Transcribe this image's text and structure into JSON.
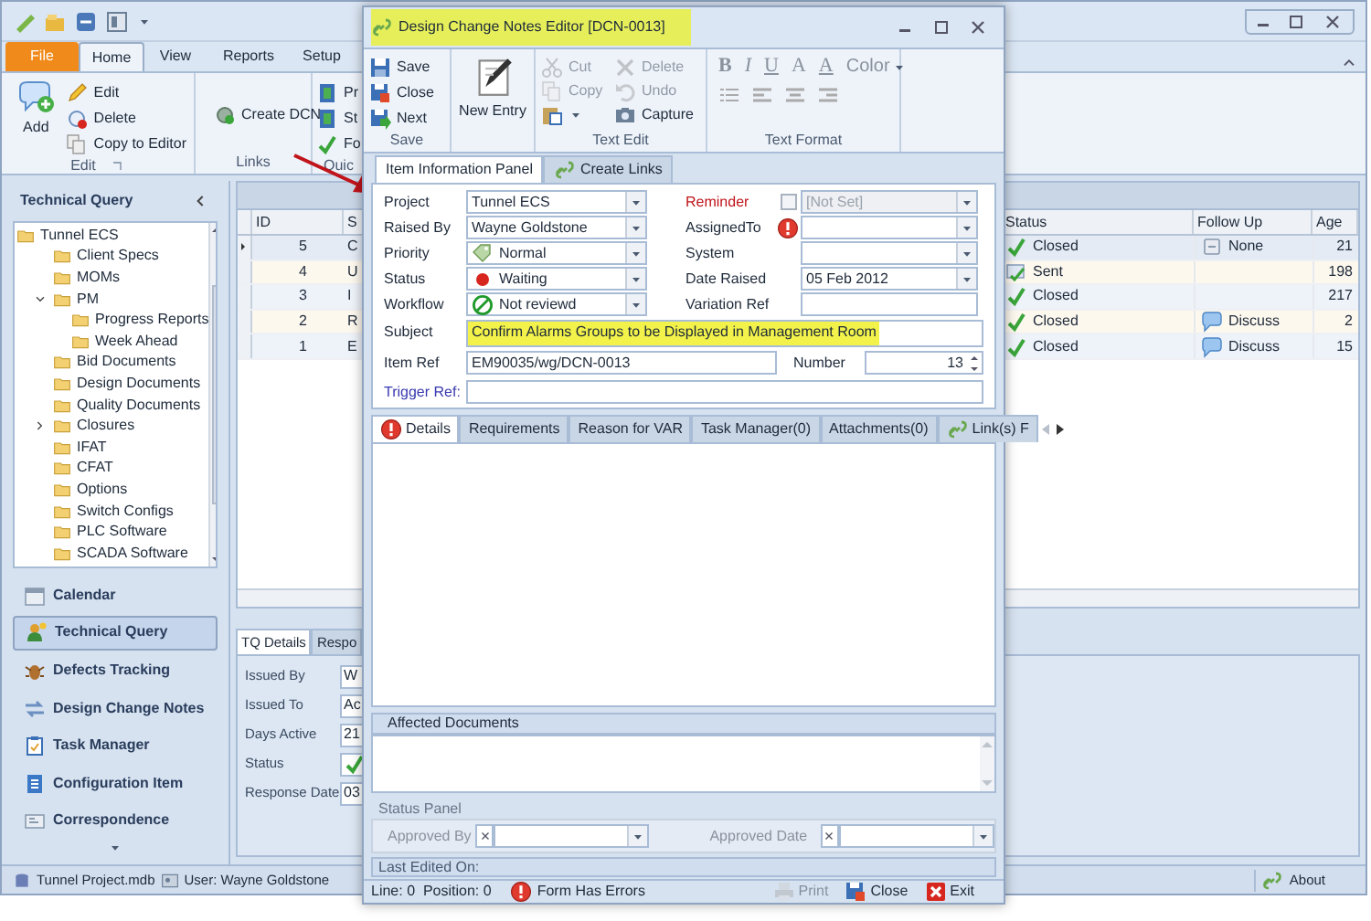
{
  "app": {
    "ribbon_tabs": [
      {
        "label": "File",
        "kind": "file",
        "selected": false
      },
      {
        "label": "Home",
        "kind": "tab",
        "selected": true
      },
      {
        "label": "View",
        "kind": "tab",
        "selected": false
      },
      {
        "label": "Reports",
        "kind": "tab",
        "selected": false
      },
      {
        "label": "Setup",
        "kind": "tab",
        "selected": false
      }
    ],
    "ribbon_groups": [
      {
        "label": "Edit",
        "large": {
          "label": "Add"
        },
        "items": [
          {
            "label": "Edit",
            "kind": "pencil"
          },
          {
            "label": "Delete",
            "kind": "minus"
          },
          {
            "label": "Copy to Editor",
            "kind": "copy"
          }
        ]
      },
      {
        "label": "Links",
        "items": [
          {
            "label": "Create DCN",
            "kind": "gear"
          }
        ]
      },
      {
        "label": "Quic",
        "items": [
          {
            "label": "Pr",
            "kind": "book"
          },
          {
            "label": "St",
            "kind": "book"
          },
          {
            "label": "Fo",
            "kind": "check"
          }
        ]
      }
    ],
    "nav": {
      "title": "Technical Query",
      "tree": [
        {
          "label": "Tunnel ECS",
          "children": [
            {
              "label": "Client Specs"
            },
            {
              "label": "MOMs"
            },
            {
              "label": "PM",
              "expanded": true,
              "children": [
                {
                  "label": "Progress Reports"
                },
                {
                  "label": "Week Ahead"
                }
              ]
            },
            {
              "label": "Bid Documents"
            },
            {
              "label": "Design Documents"
            },
            {
              "label": "Quality Documents"
            },
            {
              "label": "Closures",
              "expanded": false
            },
            {
              "label": "IFAT"
            },
            {
              "label": "CFAT"
            },
            {
              "label": "Options"
            },
            {
              "label": "Switch Configs"
            },
            {
              "label": "PLC Software"
            },
            {
              "label": "SCADA Software"
            }
          ]
        }
      ]
    },
    "nav_buttons": [
      {
        "label": "Calendar",
        "kind": "calendar",
        "selected": false
      },
      {
        "label": "Technical Query",
        "kind": "person",
        "selected": true
      },
      {
        "label": "Defects Tracking",
        "kind": "bug",
        "selected": false
      },
      {
        "label": "Design Change Notes",
        "kind": "exchange",
        "selected": false
      },
      {
        "label": "Task Manager",
        "kind": "clipboard",
        "selected": false
      },
      {
        "label": "Configuration Item",
        "kind": "document",
        "selected": false
      },
      {
        "label": "Correspondence",
        "kind": "card",
        "selected": false
      }
    ],
    "grid": {
      "columns": [
        "ID",
        "S",
        "Status",
        "Follow Up",
        "Age"
      ],
      "rows": [
        {
          "id": "5",
          "subject": "C",
          "status": {
            "label": "Closed",
            "kind": "check"
          },
          "follow_up": {
            "label": "None",
            "kind": "note"
          },
          "age": "21",
          "selected": true
        },
        {
          "id": "4",
          "subject": "U",
          "status": {
            "label": "Sent",
            "kind": "sent"
          },
          "age": "198",
          "selected": false
        },
        {
          "id": "3",
          "subject": "I",
          "status": {
            "label": "Closed",
            "kind": "check"
          },
          "age": "217",
          "selected": false
        },
        {
          "id": "2",
          "subject": "R",
          "status": {
            "label": "Closed",
            "kind": "check"
          },
          "follow_up": {
            "label": "Discuss",
            "kind": "bubble"
          },
          "age": "2",
          "selected": false
        },
        {
          "id": "1",
          "subject": "E",
          "status": {
            "label": "Closed",
            "kind": "check"
          },
          "follow_up": {
            "label": "Discuss",
            "kind": "bubble"
          },
          "age": "15",
          "selected": false
        }
      ]
    },
    "detail_tabs": [
      {
        "label": "TQ Details",
        "selected": true
      },
      {
        "label": "Respo",
        "selected": false
      }
    ],
    "detail_fields": [
      {
        "label": "Issued By",
        "value": "W"
      },
      {
        "label": "Issued To",
        "value": "Ac"
      },
      {
        "label": "Days Active",
        "value": "21"
      },
      {
        "label": "Status",
        "kind": "check"
      },
      {
        "label": "Response Date",
        "value": "03"
      }
    ],
    "status_bar": {
      "file": "Tunnel Project.mdb",
      "user": "User: Wayne Goldstone",
      "about": "About"
    }
  },
  "dialog": {
    "title": "Design Change Notes Editor [DCN-0013]",
    "ribbon": {
      "save_group": {
        "label": "Save",
        "items": [
          {
            "label": "Save",
            "kind": "save"
          },
          {
            "label": "Close",
            "kind": "close"
          },
          {
            "label": "Next",
            "kind": "next"
          }
        ]
      },
      "new_entry": "New Entry",
      "text_edit": {
        "label": "Text Edit",
        "items": [
          {
            "label": "Cut",
            "kind": "cut",
            "disabled": true
          },
          {
            "label": "Delete",
            "kind": "delete",
            "disabled": true
          },
          {
            "label": "Copy",
            "kind": "copy",
            "disabled": true
          },
          {
            "label": "Undo",
            "kind": "undo",
            "disabled": true
          },
          {
            "kind": "paste",
            "disabled": false
          },
          {
            "label": "Capture",
            "kind": "camera",
            "disabled": false
          }
        ]
      },
      "text_format": {
        "label": "Text Format",
        "glyphs": [
          {
            "label": "B",
            "kind": "bold"
          },
          {
            "label": "I",
            "kind": "italic"
          },
          {
            "label": "U",
            "kind": "underline"
          },
          {
            "label": "A",
            "kind": "plain"
          },
          {
            "label": "A",
            "kind": "underline"
          }
        ],
        "color_label": "Color"
      }
    },
    "panel_tabs": [
      {
        "label": "Item Information Panel",
        "selected": true
      },
      {
        "label": "Create Links",
        "selected": false
      }
    ],
    "left_fields": [
      {
        "label": "Project",
        "value": "Tunnel ECS"
      },
      {
        "label": "Raised By",
        "value": "Wayne Goldstone"
      },
      {
        "label": "Priority",
        "value": "Normal",
        "kind": "tag"
      },
      {
        "label": "Status",
        "value": "Waiting",
        "kind": "dot"
      },
      {
        "label": "Workflow",
        "value": "Not reviewd",
        "kind": "ring"
      }
    ],
    "right_fields": [
      {
        "label": "Reminder",
        "kind": "reminder",
        "checked": false,
        "value": "[Not Set]"
      },
      {
        "label": "AssignedTo",
        "kind": "error"
      },
      {
        "label": "System",
        "kind": "combo"
      },
      {
        "label": "Date Raised",
        "kind": "combo",
        "value": "05 Feb 2012"
      },
      {
        "label": "Variation Ref",
        "kind": "text"
      }
    ],
    "subject": {
      "label": "Subject",
      "value": "Confirm Alarms Groups to be Displayed in Management Room"
    },
    "item_ref": {
      "label": "Item Ref",
      "value": "EM90035/wg/DCN-0013"
    },
    "number": {
      "label": "Number",
      "value": "13"
    },
    "trigger_ref": {
      "label": "Trigger Ref:"
    },
    "detail_tabs": [
      {
        "label": "Details",
        "error": true,
        "selected": true
      },
      {
        "label": "Requirements",
        "selected": false
      },
      {
        "label": "Reason for VAR",
        "selected": false
      },
      {
        "label": "Task Manager(0)",
        "selected": false
      },
      {
        "label": "Attachments(0)",
        "selected": false
      },
      {
        "label": "Link(s) F",
        "link": true,
        "selected": false
      }
    ],
    "affected_documents": "Affected Documents",
    "status_panel": {
      "title": "Status Panel",
      "fields": [
        "Approved By",
        "Approved Date"
      ]
    },
    "last_edited": "Last Edited On:",
    "footer": {
      "position": "Line: 0  Position: 0",
      "error": "Form Has Errors",
      "buttons": [
        {
          "label": "Print",
          "kind": "printer",
          "disabled": true
        },
        {
          "label": "Close",
          "kind": "close",
          "disabled": false
        },
        {
          "label": "Exit",
          "kind": "exit",
          "disabled": false
        }
      ]
    }
  }
}
